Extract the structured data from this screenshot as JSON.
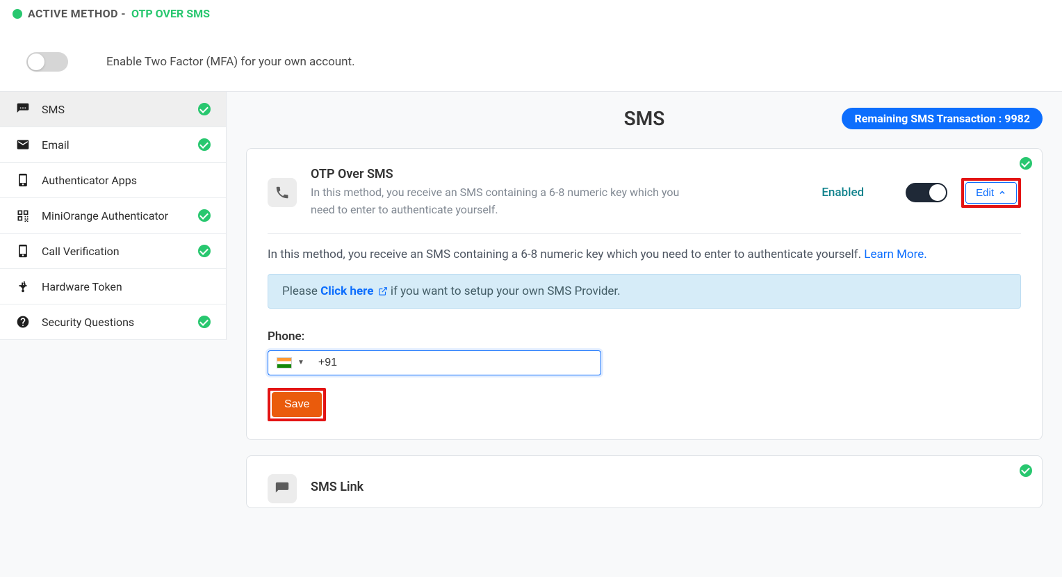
{
  "header": {
    "active_method_label": "ACTIVE METHOD -",
    "active_method_value": "OTP OVER SMS",
    "mfa_text": "Enable Two Factor (MFA) for your own account."
  },
  "sidebar": [
    {
      "label": "SMS",
      "icon": "sms",
      "check": true,
      "active": true
    },
    {
      "label": "Email",
      "icon": "email",
      "check": true,
      "active": false
    },
    {
      "label": "Authenticator Apps",
      "icon": "authapp",
      "check": false,
      "active": false
    },
    {
      "label": "MiniOrange Authenticator",
      "icon": "qr",
      "check": true,
      "active": false
    },
    {
      "label": "Call Verification",
      "icon": "call",
      "check": true,
      "active": false
    },
    {
      "label": "Hardware Token",
      "icon": "usb",
      "check": false,
      "active": false
    },
    {
      "label": "Security Questions",
      "icon": "question",
      "check": true,
      "active": false
    }
  ],
  "main": {
    "title": "SMS",
    "remaining_label": "Remaining SMS Transaction : 9982"
  },
  "otp_card": {
    "title": "OTP Over SMS",
    "desc": "In this method, you receive an SMS containing a 6-8 numeric key which you need to enter to authenticate yourself.",
    "enabled": "Enabled",
    "edit": "Edit",
    "body_text_start": "In this method, you receive an SMS containing a 6-8 numeric key which you need to enter to authenticate yourself. ",
    "learn_more": "Learn More.",
    "info_prefix": "Please ",
    "info_link": "Click here",
    "info_suffix": " if you want to setup your own SMS Provider.",
    "phone_label": "Phone:",
    "phone_value": "+91",
    "save": "Save"
  },
  "card2": {
    "title": "SMS Link"
  }
}
